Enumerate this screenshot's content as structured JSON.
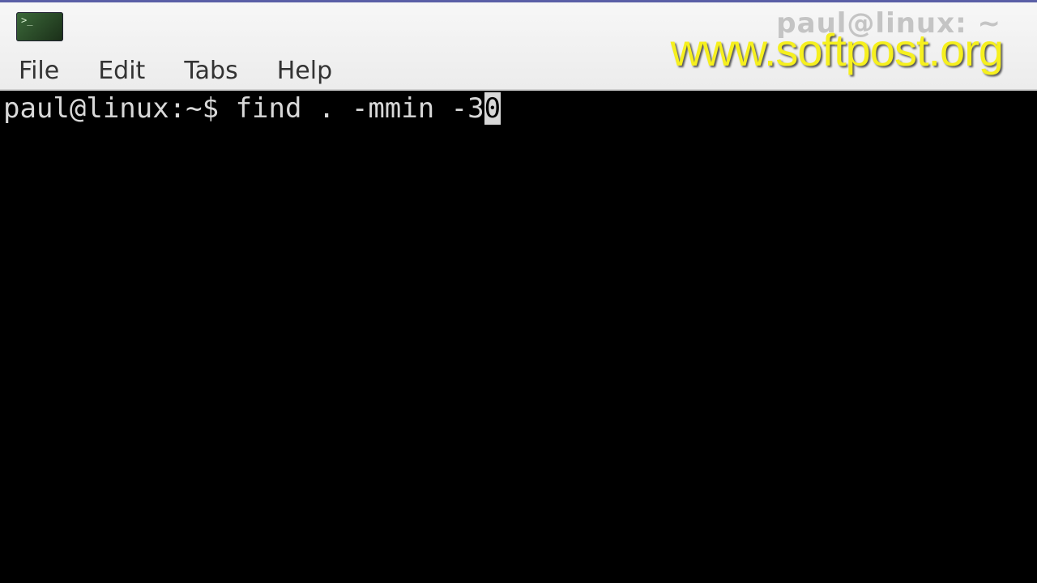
{
  "window": {
    "title": "paul@linux: ~",
    "watermark": "www.softpost.org"
  },
  "app_icon": {
    "glyph": ">_"
  },
  "menu": {
    "items": [
      "File",
      "Edit",
      "Tabs",
      "Help"
    ]
  },
  "terminal": {
    "prompt": "paul@linux:~$ ",
    "command": "find . -mmin -3",
    "cursor_char": "0"
  },
  "colors": {
    "watermark": "#f6f01e",
    "terminal_bg": "#000000",
    "terminal_fg": "#d8d8d8"
  }
}
